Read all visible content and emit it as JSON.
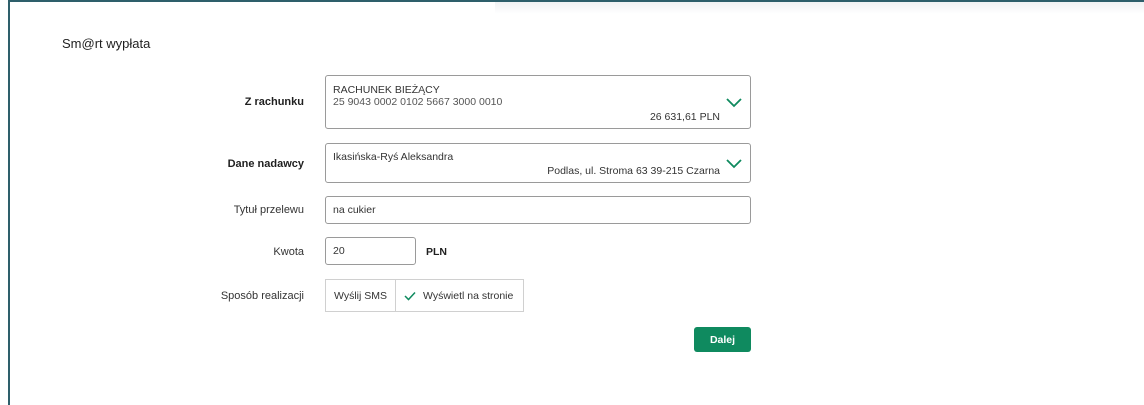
{
  "page": {
    "title": "Sm@rt wypłata"
  },
  "form": {
    "from_account": {
      "label": "Z rachunku",
      "account_name": "RACHUNEK BIEŻĄCY",
      "account_number": "25 9043 0002 0102 5667 3000 0010",
      "balance": "26 631,61 PLN"
    },
    "sender": {
      "label": "Dane nadawcy",
      "name": "Ikasińska-Ryś Aleksandra",
      "address": "Podlas, ul. Stroma 63 39-215 Czarna"
    },
    "title": {
      "label": "Tytuł przelewu",
      "value": "na cukier"
    },
    "amount": {
      "label": "Kwota",
      "value": "20",
      "currency": "PLN"
    },
    "method": {
      "label": "Sposób realizacji",
      "options": [
        "Wyślij SMS",
        "Wyświetl na stronie"
      ],
      "selected": "Wyświetl na stronie"
    },
    "next_label": "Dalej"
  },
  "colors": {
    "accent": "#0f8a5f",
    "frame": "#2e5f6b"
  },
  "icons": {
    "dropdown": "chevron-down-icon",
    "selected": "check-icon"
  }
}
